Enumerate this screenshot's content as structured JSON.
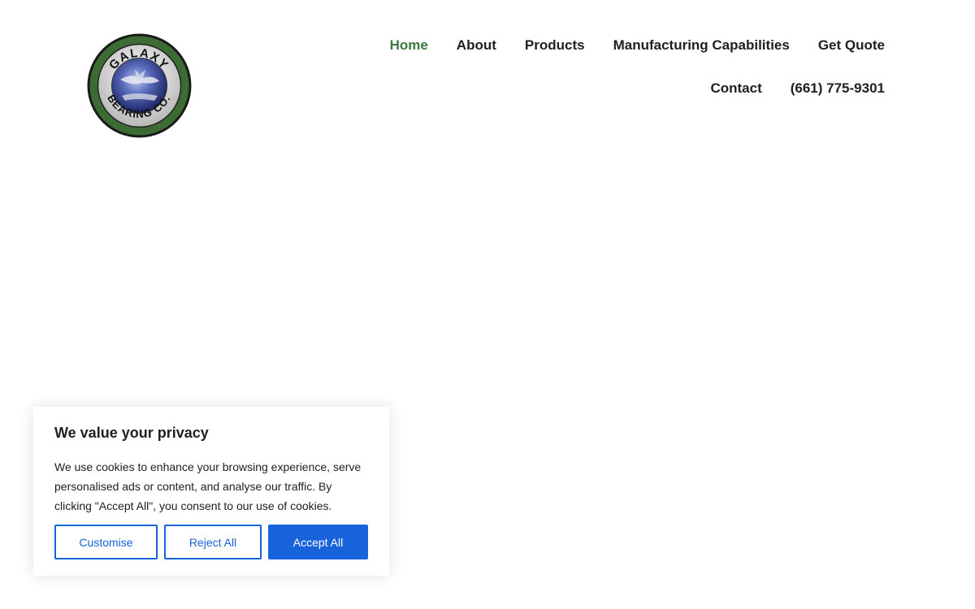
{
  "header": {
    "logo": {
      "text_top": "GALAXY",
      "text_bottom": "BEARING CO."
    },
    "nav": {
      "row1": [
        {
          "label": "Home",
          "active": true
        },
        {
          "label": "About"
        },
        {
          "label": "Products"
        },
        {
          "label": "Manufacturing Capabilities"
        },
        {
          "label": "Get Quote"
        }
      ],
      "row2": [
        {
          "label": "Contact"
        },
        {
          "label": "(661) 775-9301"
        }
      ]
    }
  },
  "cookie_banner": {
    "title": "We value your privacy",
    "text": "We use cookies to enhance your browsing experience, serve personalised ads or content, and analyse our traffic. By clicking \"Accept All\", you consent to our use of cookies.",
    "buttons": {
      "customise": "Customise",
      "reject": "Reject All",
      "accept": "Accept All"
    }
  },
  "colors": {
    "nav_active": "#3b7a3c",
    "nav_text": "#1f1f1f",
    "primary_button": "#1863dc",
    "logo_ring": "#3d6b34"
  }
}
